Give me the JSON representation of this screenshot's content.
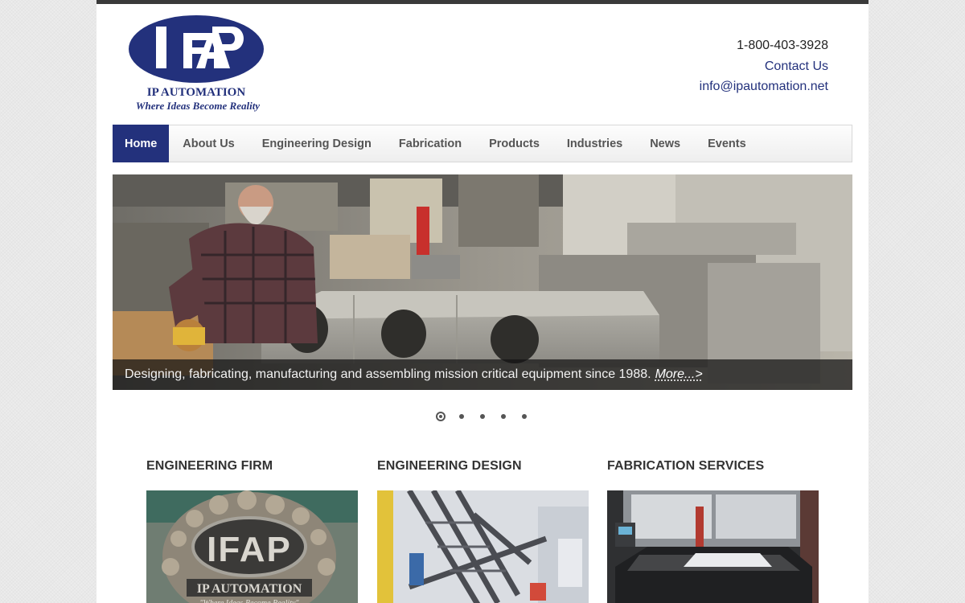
{
  "header": {
    "logo_text": "IFAP",
    "logo_name": "IP AUTOMATION",
    "logo_tagline": "Where Ideas Become Reality",
    "phone": "1-800-403-3928",
    "contact_link": "Contact Us",
    "email": "info@ipautomation.net"
  },
  "nav": {
    "items": [
      {
        "label": "Home",
        "active": true
      },
      {
        "label": "About Us"
      },
      {
        "label": "Engineering Design"
      },
      {
        "label": "Fabrication"
      },
      {
        "label": "Products"
      },
      {
        "label": "Industries"
      },
      {
        "label": "News"
      },
      {
        "label": "Events"
      }
    ]
  },
  "slider": {
    "caption": "Designing, fabricating, manufacturing and assembling mission critical equipment since 1988.",
    "more_link": "More...>",
    "slide_count": 5,
    "active_slide": 1
  },
  "features": [
    {
      "title": "ENGINEERING FIRM"
    },
    {
      "title": "ENGINEERING DESIGN"
    },
    {
      "title": "FABRICATION SERVICES"
    }
  ],
  "colors": {
    "brand_navy": "#23317c",
    "top_bar": "#3a3a3a"
  }
}
